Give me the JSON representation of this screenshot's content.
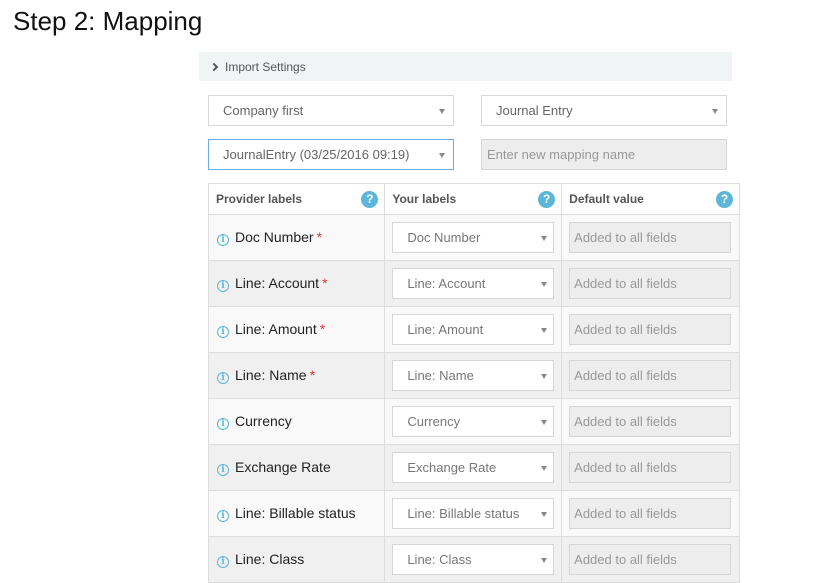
{
  "page": {
    "title": "Step 2: Mapping"
  },
  "import_settings": {
    "label": "Import Settings",
    "icon": "chevron-right-icon"
  },
  "controls": {
    "company_select": {
      "value": "Company first"
    },
    "entity_select": {
      "value": "Journal Entry"
    },
    "mapping_select": {
      "value": "JournalEntry (03/25/2016 09:19)"
    },
    "mapping_name_input": {
      "value": "",
      "placeholder": "Enter new mapping name"
    }
  },
  "table": {
    "headers": [
      {
        "label": "Provider labels",
        "icon": "help-icon"
      },
      {
        "label": "Your labels",
        "icon": "help-icon"
      },
      {
        "label": "Default value",
        "icon": "help-icon"
      }
    ],
    "rows": [
      {
        "provider": "Doc Number",
        "required": "*",
        "your_label": "Doc Number",
        "default_placeholder": "Added to all fields"
      },
      {
        "provider": "Line: Account",
        "required": "*",
        "your_label": "Line: Account",
        "default_placeholder": "Added to all fields"
      },
      {
        "provider": "Line: Amount",
        "required": "*",
        "your_label": "Line: Amount",
        "default_placeholder": "Added to all fields"
      },
      {
        "provider": "Line: Name",
        "required": "*",
        "your_label": "Line: Name",
        "default_placeholder": "Added to all fields"
      },
      {
        "provider": "Currency",
        "required": "",
        "your_label": "Currency",
        "default_placeholder": "Added to all fields"
      },
      {
        "provider": "Exchange Rate",
        "required": "",
        "your_label": "Exchange Rate",
        "default_placeholder": "Added to all fields"
      },
      {
        "provider": "Line: Billable status",
        "required": "",
        "your_label": "Line: Billable status",
        "default_placeholder": "Added to all fields"
      },
      {
        "provider": "Line: Class",
        "required": "",
        "your_label": "Line: Class",
        "default_placeholder": "Added to all fields"
      }
    ]
  },
  "icons": {
    "help": "?",
    "info": "i"
  },
  "colors": {
    "accent": "#5bb6d9",
    "required": "#e53935",
    "focus_border": "#66afe9"
  }
}
